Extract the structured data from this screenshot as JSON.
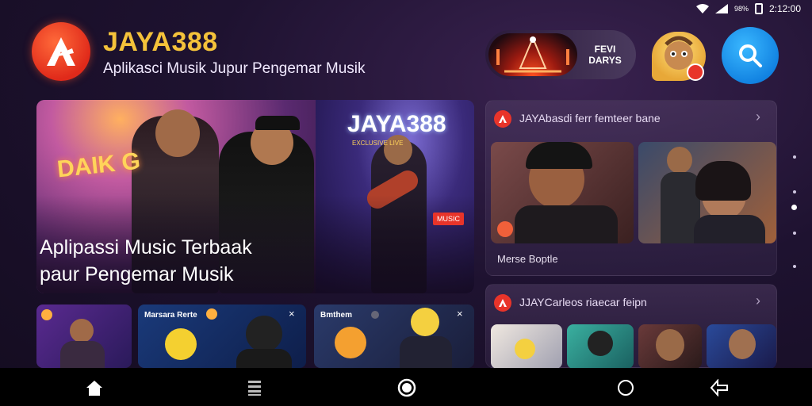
{
  "status_bar": {
    "signal_text": "98%",
    "time": "2:12:00"
  },
  "header": {
    "app_name": "JAYA388",
    "tagline": "Aplikasci Musik Jupur Pengemar Musik",
    "promo_label_line1": "FEVI",
    "promo_label_line2": "DARYS"
  },
  "hero": {
    "sign_text": "DAIK G",
    "brand": "JAYA388",
    "brand_sub": "EXCLUSIVE LIVE",
    "live_badge": "MUSIC",
    "title": "Aplipassi Music Terbaak",
    "subtitle": "paur Pengemar Musik"
  },
  "cards": [
    {
      "label": "",
      "close": ""
    },
    {
      "label": "Marsara Rerte",
      "close": "×"
    },
    {
      "label": "Bmthem",
      "close": "×"
    }
  ],
  "panels": [
    {
      "title": "JAYAbasdi ferr femteer bane",
      "thumb_caption": "Merse Boptle",
      "chevron": "›"
    },
    {
      "title": "JJAYCarleos riaecar feipn",
      "chevron": "›"
    }
  ],
  "colors": {
    "accent_gold": "#f4c23a",
    "accent_red": "#e8342a",
    "accent_blue": "#1f9cf0"
  },
  "icons": [
    "logo-icon",
    "search-icon",
    "home-icon",
    "menu-icon",
    "record-icon",
    "circle-icon",
    "back-icon"
  ]
}
